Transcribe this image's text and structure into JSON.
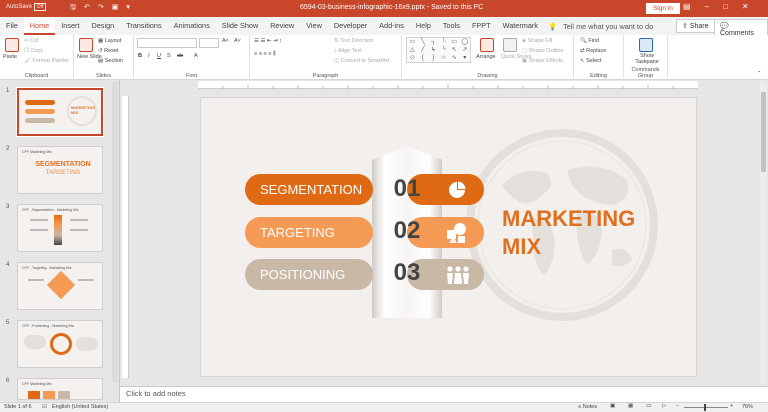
{
  "titlebar": {
    "autosave": "AutoSave",
    "autosave_state": "Off",
    "document": "6594-03-business-infographic-16x9.pptx  -  Saved to this PC",
    "signin": "Sign in"
  },
  "tabs": [
    "File",
    "Home",
    "Insert",
    "Design",
    "Transitions",
    "Animations",
    "Slide Show",
    "Review",
    "View",
    "Developer",
    "Add-ins",
    "Help",
    "Tools",
    "FPPT",
    "Watermark"
  ],
  "tellme": "Tell me what you want to do",
  "share": "Share",
  "comments": "Comments",
  "ribbon": {
    "clipboard": {
      "label": "Clipboard",
      "paste": "Paste",
      "cut": "Cut",
      "copy": "Copy",
      "format_painter": "Format Painter"
    },
    "slides": {
      "label": "Slides",
      "new_slide": "New Slide",
      "layout": "Layout",
      "reset": "Reset",
      "section": "Section"
    },
    "font": {
      "label": "Font"
    },
    "paragraph": {
      "label": "Paragraph",
      "text_direction": "Text Direction",
      "align_text": "Align Text",
      "convert": "Convert to SmartArt"
    },
    "drawing": {
      "label": "Drawing",
      "arrange": "Arrange",
      "quick_styles": "Quick Styles",
      "shape_fill": "Shape Fill",
      "shape_outline": "Shape Outline",
      "shape_effects": "Shape Effects"
    },
    "editing": {
      "label": "Editing",
      "find": "Find",
      "replace": "Replace",
      "select": "Select"
    },
    "commands": {
      "label": "Commands Group",
      "show_taskpane": "Show Taskpane"
    }
  },
  "thumbnails": [
    {
      "num": "1",
      "heading": "",
      "title": "",
      "subtitle": ""
    },
    {
      "num": "2",
      "heading": "CPF Marketing Mix",
      "title": "SEGMENTATION",
      "subtitle": "TARGETING"
    },
    {
      "num": "3",
      "heading": "CPF - Segmentation - Marketing Mix",
      "title": "",
      "subtitle": ""
    },
    {
      "num": "4",
      "heading": "CPF - Targeting - Marketing Mix",
      "title": "",
      "subtitle": ""
    },
    {
      "num": "5",
      "heading": "CPF - Positioning - Marketing Mix",
      "title": "",
      "subtitle": ""
    },
    {
      "num": "6",
      "heading": "CPF Marketing Mix",
      "title": "",
      "subtitle": ""
    }
  ],
  "slide": {
    "items": [
      {
        "label": "SEGMENTATION",
        "number": "01"
      },
      {
        "label": "TARGETING",
        "number": "02"
      },
      {
        "label": "POSITIONING",
        "number": "03"
      }
    ],
    "title_line1": "MARKETING",
    "title_line2": "MIX"
  },
  "notes_placeholder": "Click to add notes",
  "status": {
    "slide": "Slide 1 of 6",
    "language": "English (United States)",
    "notes": "Notes",
    "zoom": "76%"
  },
  "colors": {
    "accent": "#c8472a",
    "orange": "#e06a13",
    "light_orange": "#f49a55",
    "beige": "#c9b8a6"
  }
}
